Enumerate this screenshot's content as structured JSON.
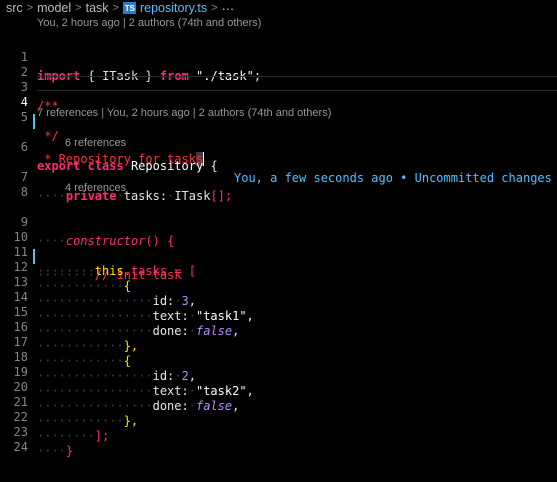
{
  "breadcrumb": {
    "items": [
      "src",
      "model",
      "task"
    ],
    "file_icon_label": "TS",
    "file": "repository.ts",
    "more": "⋯"
  },
  "codelens": {
    "top": "You, 2 hours ago | 2 authors (74th and others)",
    "class": "7 references | You, 2 hours ago | 2 authors (74th and others)",
    "tasks": "6 references",
    "ctor": "4 references"
  },
  "blame": "You, a few seconds ago • Uncommitted changes",
  "line_numbers": [
    "1",
    "2",
    "3",
    "4",
    "5",
    "6",
    "7",
    "8",
    "9",
    "10",
    "11",
    "12",
    "13",
    "14",
    "15",
    "16",
    "17",
    "18",
    "19",
    "20",
    "21",
    "22",
    "23",
    "24"
  ],
  "code": {
    "l1": {
      "kw": "import",
      "open": "{",
      "type": "ITask",
      "close": "}",
      "from": "from",
      "str": "\"./task\"",
      "end": ";"
    },
    "l3": "/**",
    "l4a": " * Repository for task",
    "l4b": "s",
    "l5": " */",
    "l6": {
      "kw1": "export",
      "kw2": "class",
      "name": "Repository",
      "brace": "{"
    },
    "l7": {
      "kw": "private",
      "prop": "tasks",
      "colon": ":",
      "type": "ITask",
      "rest": "[];"
    },
    "l9": {
      "fn": "constructor",
      "rest": "() {"
    },
    "l10": "// init task",
    "l11": {
      "this": "this",
      "rest": ".tasks = ["
    },
    "l12": "{",
    "l13": {
      "key": "id",
      "colon": ":",
      "val": "3",
      "end": ","
    },
    "l14": {
      "key": "text",
      "colon": ":",
      "val": "\"task1\"",
      "end": ","
    },
    "l15": {
      "key": "done",
      "colon": ":",
      "val": "false",
      "end": ","
    },
    "l16": "},",
    "l17": "{",
    "l18": {
      "key": "id",
      "colon": ":",
      "val": "2",
      "end": ","
    },
    "l19": {
      "key": "text",
      "colon": ":",
      "val": "\"task2\"",
      "end": ","
    },
    "l20": {
      "key": "done",
      "colon": ":",
      "val": "false",
      "end": ","
    },
    "l21": "},",
    "l22": "];",
    "l23": "}"
  }
}
